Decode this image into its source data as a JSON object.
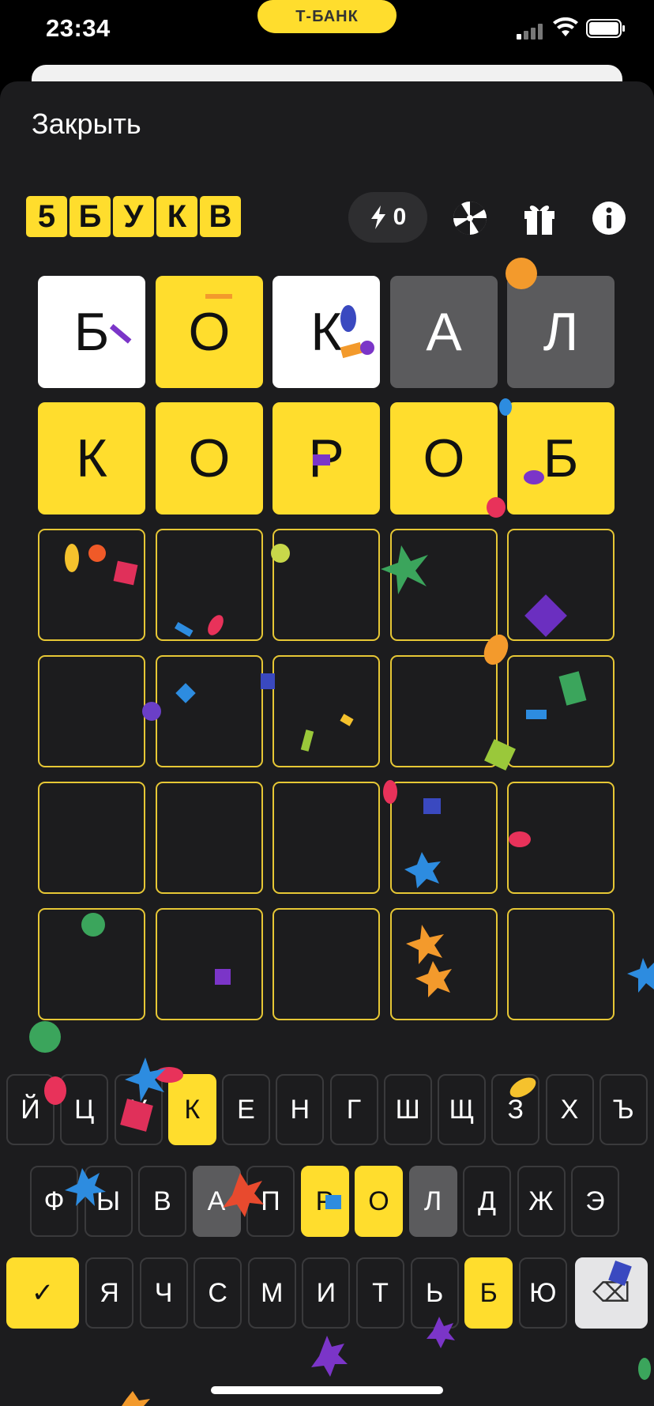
{
  "status_bar": {
    "time": "23:34",
    "bank_pill": "Т-БАНК"
  },
  "header": {
    "close_label": "Закрыть",
    "logo_letters": [
      "5",
      "Б",
      "У",
      "К",
      "В"
    ],
    "energy_count": "0",
    "icons": [
      "lightning-icon",
      "wheel-icon",
      "gift-icon",
      "info-icon"
    ]
  },
  "board": {
    "rows": [
      [
        {
          "letter": "Б",
          "state": "white"
        },
        {
          "letter": "О",
          "state": "yellow"
        },
        {
          "letter": "К",
          "state": "white"
        },
        {
          "letter": "А",
          "state": "gray"
        },
        {
          "letter": "Л",
          "state": "gray"
        }
      ],
      [
        {
          "letter": "К",
          "state": "yellow"
        },
        {
          "letter": "О",
          "state": "yellow"
        },
        {
          "letter": "Р",
          "state": "yellow"
        },
        {
          "letter": "О",
          "state": "yellow"
        },
        {
          "letter": "Б",
          "state": "yellow"
        }
      ],
      [
        {
          "letter": "",
          "state": "empty"
        },
        {
          "letter": "",
          "state": "empty"
        },
        {
          "letter": "",
          "state": "empty"
        },
        {
          "letter": "",
          "state": "empty"
        },
        {
          "letter": "",
          "state": "empty"
        }
      ],
      [
        {
          "letter": "",
          "state": "empty"
        },
        {
          "letter": "",
          "state": "empty"
        },
        {
          "letter": "",
          "state": "empty"
        },
        {
          "letter": "",
          "state": "empty"
        },
        {
          "letter": "",
          "state": "empty"
        }
      ],
      [
        {
          "letter": "",
          "state": "empty"
        },
        {
          "letter": "",
          "state": "empty"
        },
        {
          "letter": "",
          "state": "empty"
        },
        {
          "letter": "",
          "state": "empty"
        },
        {
          "letter": "",
          "state": "empty"
        }
      ],
      [
        {
          "letter": "",
          "state": "empty"
        },
        {
          "letter": "",
          "state": "empty"
        },
        {
          "letter": "",
          "state": "empty"
        },
        {
          "letter": "",
          "state": "empty"
        },
        {
          "letter": "",
          "state": "empty"
        }
      ]
    ]
  },
  "keyboard": {
    "rows": [
      [
        {
          "k": "Й",
          "s": "normal"
        },
        {
          "k": "Ц",
          "s": "normal"
        },
        {
          "k": "У",
          "s": "normal"
        },
        {
          "k": "К",
          "s": "yellow"
        },
        {
          "k": "Е",
          "s": "normal"
        },
        {
          "k": "Н",
          "s": "normal"
        },
        {
          "k": "Г",
          "s": "normal"
        },
        {
          "k": "Ш",
          "s": "normal"
        },
        {
          "k": "Щ",
          "s": "normal"
        },
        {
          "k": "З",
          "s": "normal"
        },
        {
          "k": "Х",
          "s": "normal"
        },
        {
          "k": "Ъ",
          "s": "normal"
        }
      ],
      [
        {
          "k": "Ф",
          "s": "normal"
        },
        {
          "k": "Ы",
          "s": "normal"
        },
        {
          "k": "В",
          "s": "normal"
        },
        {
          "k": "А",
          "s": "gray"
        },
        {
          "k": "П",
          "s": "normal"
        },
        {
          "k": "Р",
          "s": "yellow"
        },
        {
          "k": "О",
          "s": "yellow"
        },
        {
          "k": "Л",
          "s": "gray"
        },
        {
          "k": "Д",
          "s": "normal"
        },
        {
          "k": "Ж",
          "s": "normal"
        },
        {
          "k": "Э",
          "s": "normal"
        }
      ],
      [
        {
          "k": "✓",
          "s": "enter"
        },
        {
          "k": "Я",
          "s": "normal"
        },
        {
          "k": "Ч",
          "s": "normal"
        },
        {
          "k": "С",
          "s": "normal"
        },
        {
          "k": "М",
          "s": "normal"
        },
        {
          "k": "И",
          "s": "normal"
        },
        {
          "k": "Т",
          "s": "normal"
        },
        {
          "k": "Ь",
          "s": "normal"
        },
        {
          "k": "Б",
          "s": "yellow"
        },
        {
          "k": "Ю",
          "s": "normal"
        },
        {
          "k": "⌫",
          "s": "backspace"
        }
      ]
    ]
  },
  "colors": {
    "accent": "#FFDD2D",
    "tile_gray": "#5B5B5D",
    "sheet": "#1C1C1E",
    "empty_border": "#E6C735"
  }
}
